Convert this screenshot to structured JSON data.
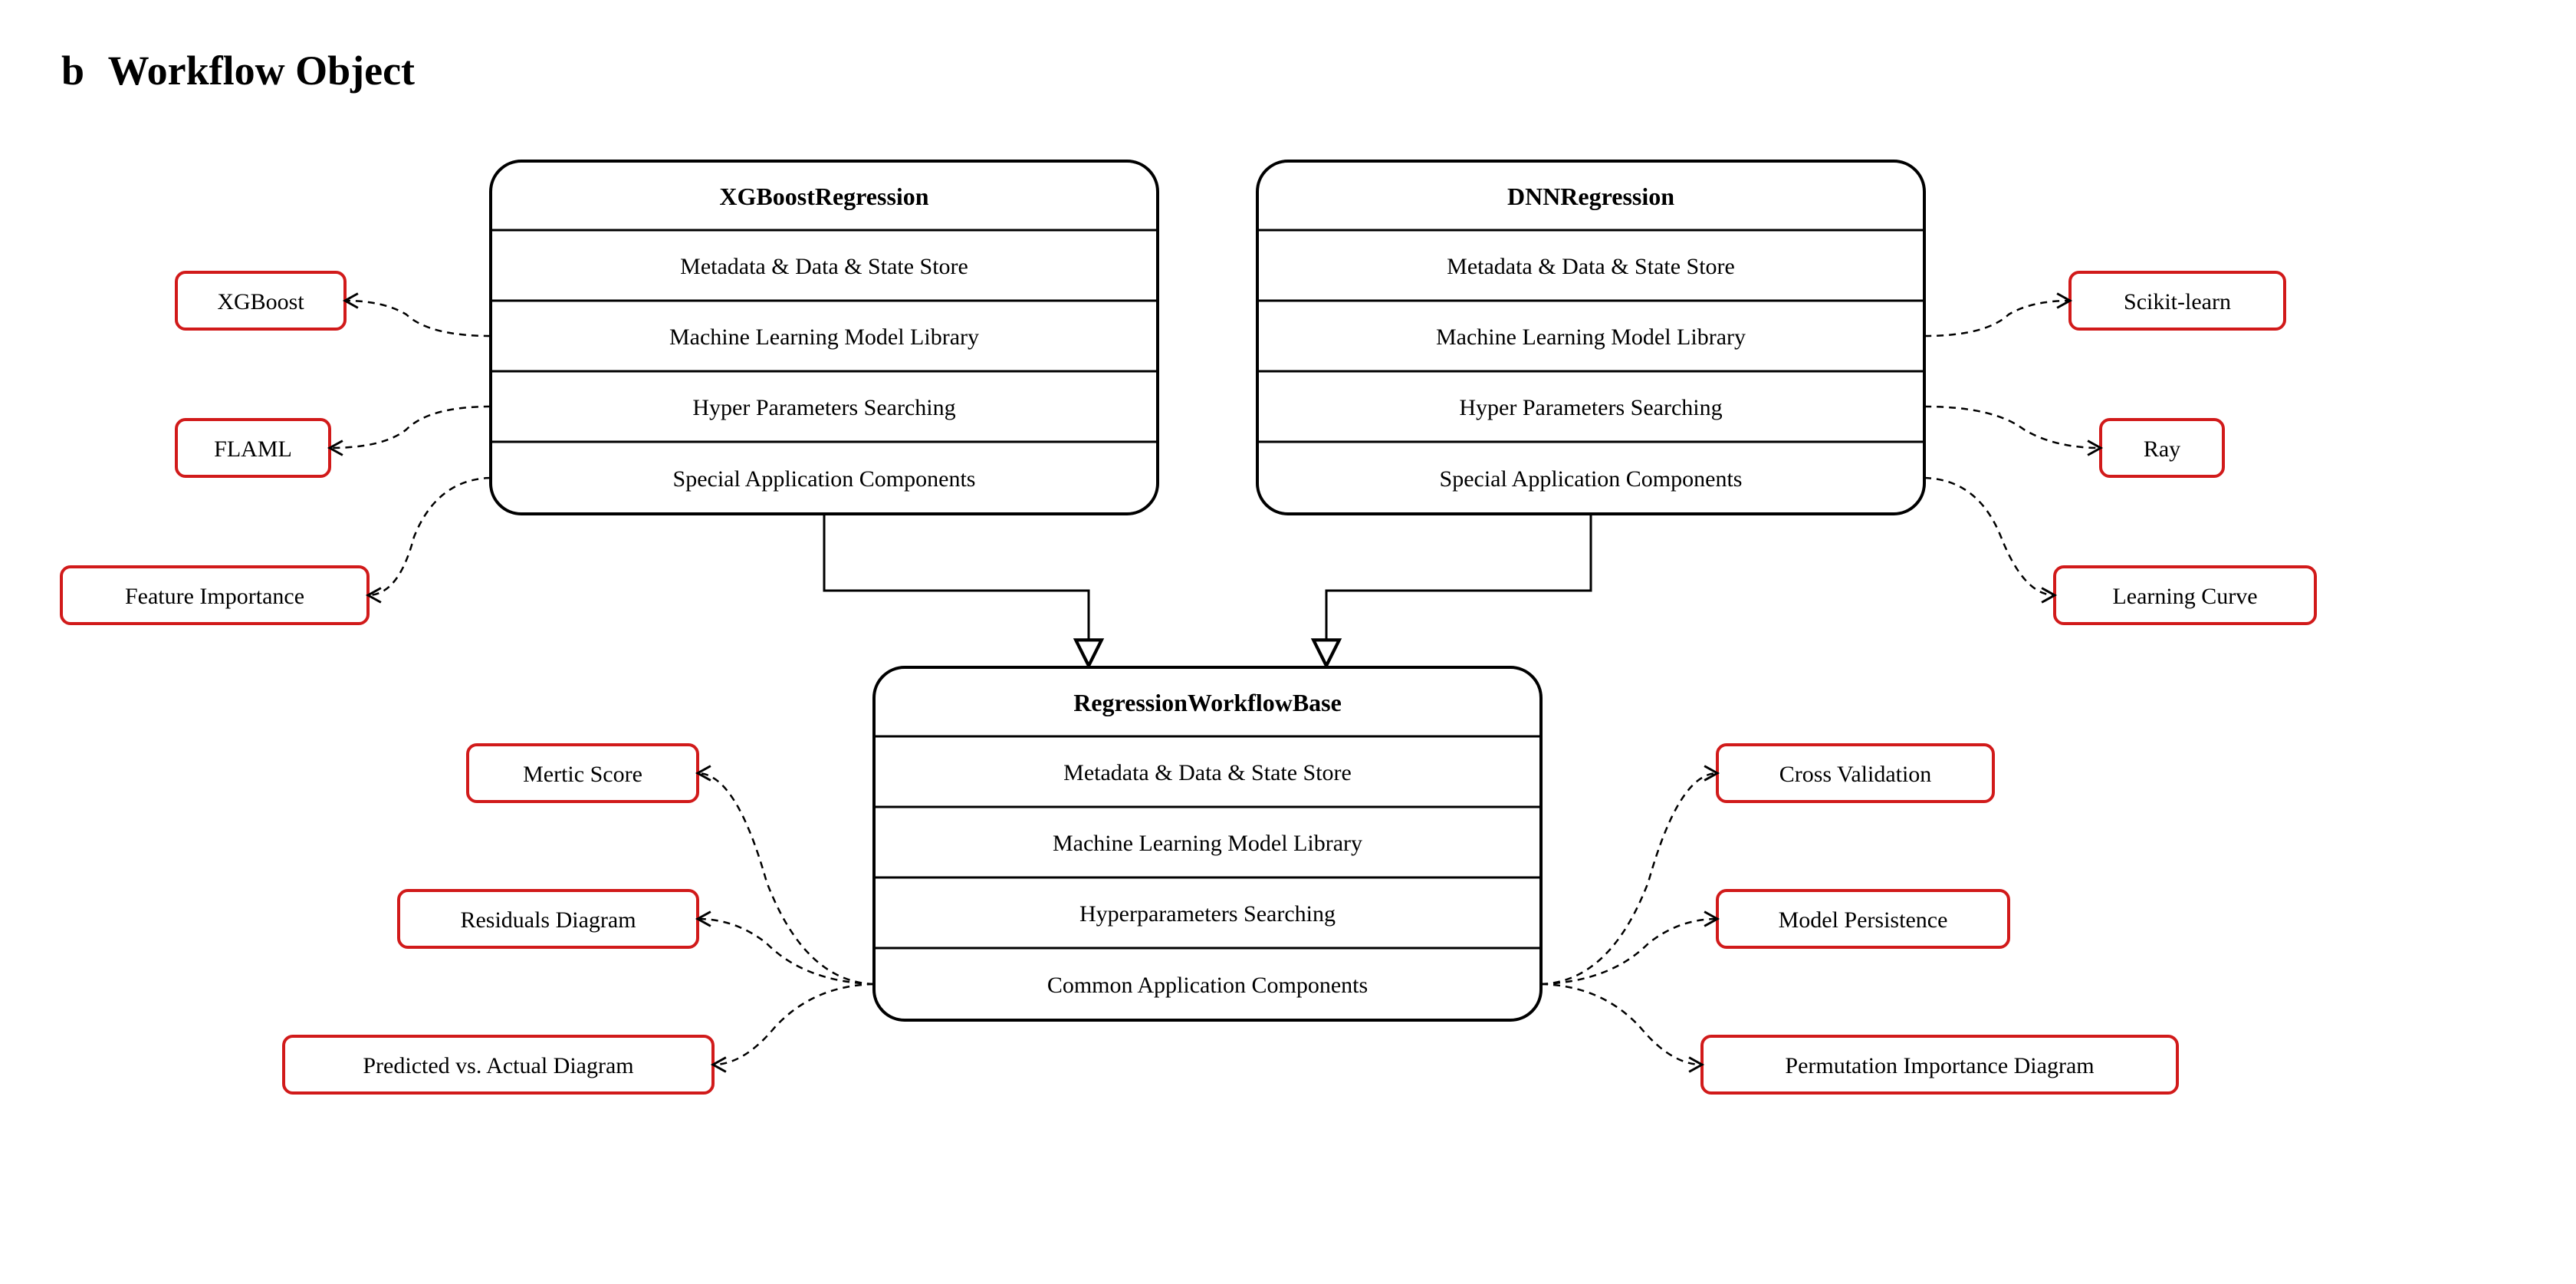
{
  "panel_label": "b",
  "panel_title": "Workflow Object",
  "main_boxes": {
    "xgb": {
      "title": "XGBoostRegression",
      "rows": [
        "Metadata & Data & State Store",
        "Machine Learning Model Library",
        "Hyper Parameters Searching",
        "Special Application Components"
      ]
    },
    "dnn": {
      "title": "DNNRegression",
      "rows": [
        "Metadata & Data & State Store",
        "Machine Learning Model Library",
        "Hyper Parameters Searching",
        "Special Application Components"
      ]
    },
    "base": {
      "title": "RegressionWorkflowBase",
      "rows": [
        "Metadata & Data & State Store",
        "Machine Learning Model Library",
        "Hyperparameters Searching",
        "Common Application Components"
      ]
    }
  },
  "side_boxes": {
    "xgb_left": [
      "XGBoost",
      "FLAML",
      "Feature Importance"
    ],
    "dnn_right": [
      "Scikit-learn",
      "Ray",
      "Learning Curve"
    ],
    "base_left": [
      "Mertic Score",
      "Residuals Diagram",
      "Predicted vs. Actual Diagram"
    ],
    "base_right": [
      "Cross Validation",
      "Model Persistence",
      "Permutation Importance Diagram"
    ]
  },
  "colors": {
    "red_stroke": "#d11a1a",
    "black": "#000000"
  }
}
